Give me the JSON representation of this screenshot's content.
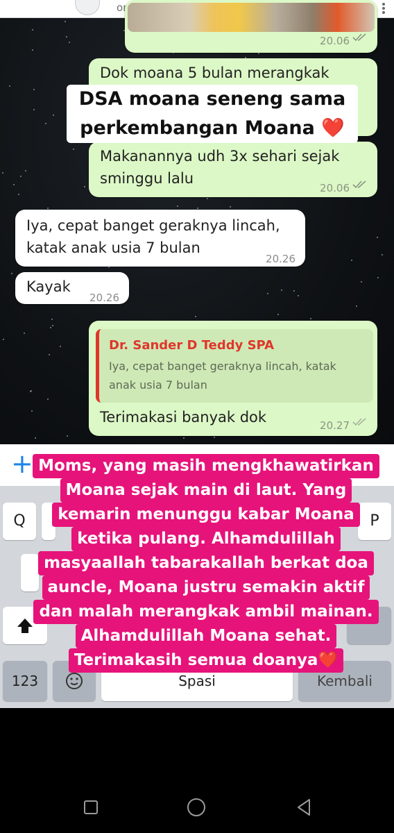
{
  "header": {
    "status": "online"
  },
  "chat": {
    "photo_msg": {
      "time": "20.06"
    },
    "msg1": {
      "text": "Dok moana 5 bulan merangkak"
    },
    "msg2": {
      "lines": [
        "Makanannya udh 3x sehari sejak",
        "sminggu lalu"
      ],
      "time": "20.06"
    },
    "msg3": {
      "lines": [
        "Iya, cepat banget geraknya lincah,",
        "katak anak usia 7 bulan"
      ],
      "time": "20.26"
    },
    "msg4": {
      "text": "Kayak",
      "time": "20.26"
    },
    "msg5": {
      "reply_name": "Dr. Sander D Teddy SPA",
      "reply_lines": [
        "Iya, cepat banget geraknya lincah, katak",
        "anak usia 7 bulan"
      ],
      "text": "Terimakasi banyak dok",
      "time": "20.27"
    }
  },
  "overlay": {
    "top_lines": [
      "DSA moana seneng sama",
      "perkembangan Moana ❤️"
    ],
    "main_lines": [
      "Moms, yang masih mengkhawatirkan",
      "Moana sejak main di laut. Yang",
      "kemarin menunggu kabar Moana",
      "ketika pulang. Alhamdulillah",
      "masyaallah tabarakallah berkat doa",
      "auncle, Moana justru semakin aktif",
      "dan malah merangkak ambil mainan.",
      "Alhamdulillah Moana sehat.",
      "Terimakasih semua doanya❤️"
    ]
  },
  "keyboard": {
    "plus_icon": "+",
    "key_q": "Q",
    "key_p": "P",
    "key_123": "123",
    "key_spasi": "Spasi",
    "key_kembali": "Kembali"
  },
  "colors": {
    "accent_pink": "#e6137a",
    "bubble_out": "#dcf8c6",
    "reply_name": "#e0362b",
    "plus_blue": "#1d86e8"
  }
}
